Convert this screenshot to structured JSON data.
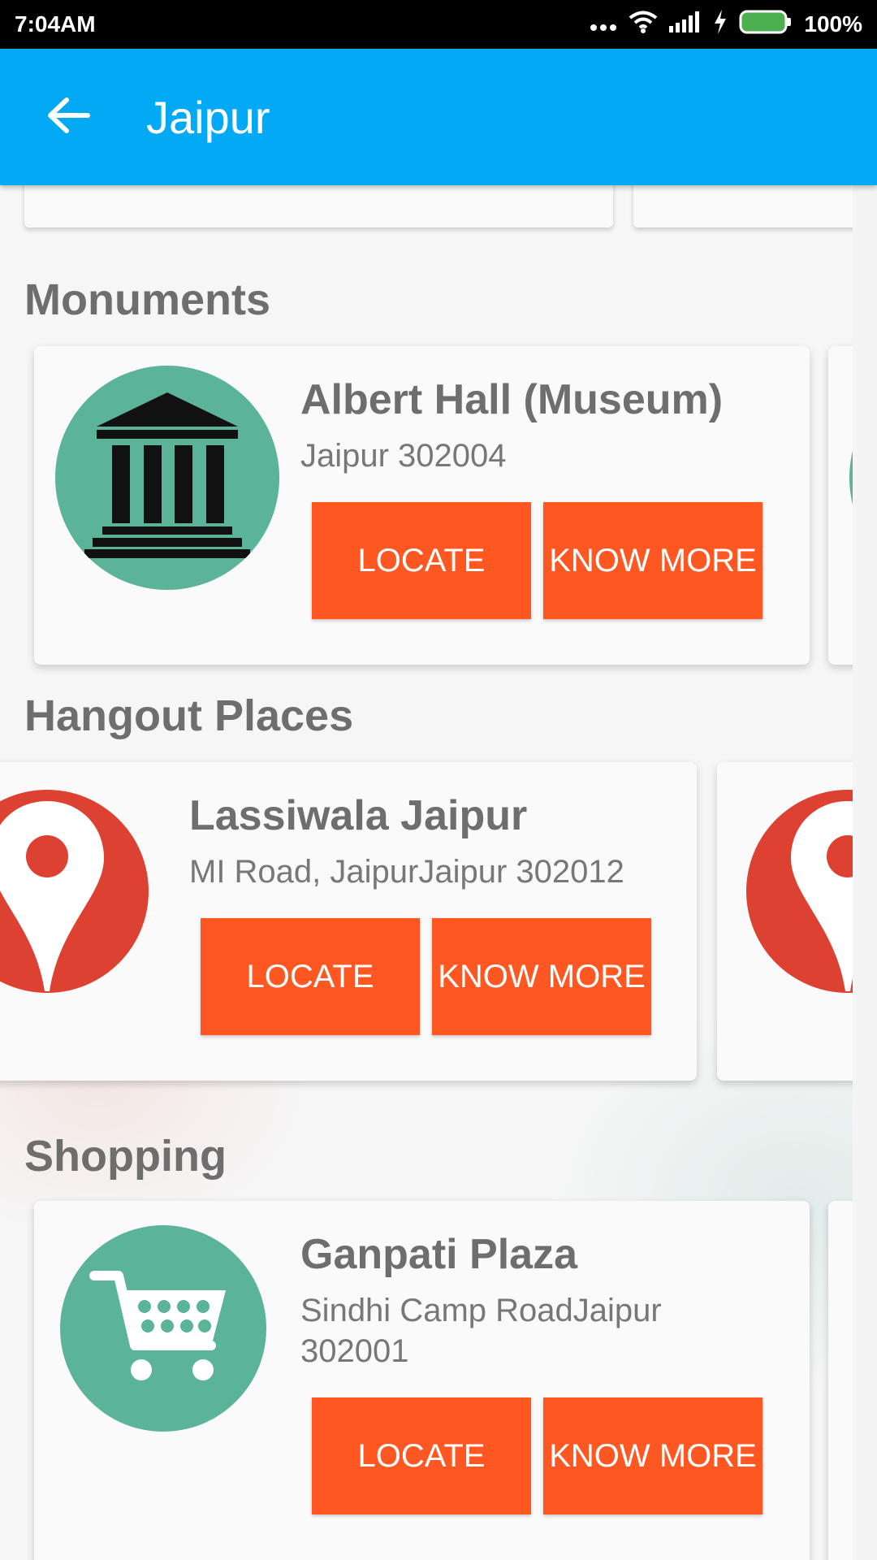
{
  "status_bar": {
    "time": "7:04AM",
    "battery": "100%",
    "icons": [
      "more-dots-icon",
      "wifi-icon",
      "signal-icon",
      "charging-icon",
      "battery-icon"
    ]
  },
  "app_bar": {
    "title": "Jaipur",
    "back_icon": "arrow-back-icon",
    "color": "#03a9f4"
  },
  "accent_color": "#ff5722",
  "sections": [
    {
      "title": "Monuments",
      "card": {
        "name": "Albert Hall (Museum)",
        "address": "Jaipur 302004",
        "icon": "museum-icon",
        "icon_color": "#5bb39a",
        "locate_label": "LOCATE",
        "know_more_label": "KNOW MORE"
      }
    },
    {
      "title": "Hangout Places",
      "card": {
        "name": "Lassiwala Jaipur",
        "address": "MI Road, JaipurJaipur 302012",
        "icon": "map-pin-icon",
        "icon_color": "#dd4132",
        "locate_label": "LOCATE",
        "know_more_label": "KNOW MORE"
      }
    },
    {
      "title": "Shopping",
      "card": {
        "name": "Ganpati Plaza",
        "address": "Sindhi Camp RoadJaipur 302001",
        "icon": "shopping-cart-icon",
        "icon_color": "#5bb39a",
        "locate_label": "LOCATE",
        "know_more_label": "KNOW MORE"
      }
    }
  ]
}
